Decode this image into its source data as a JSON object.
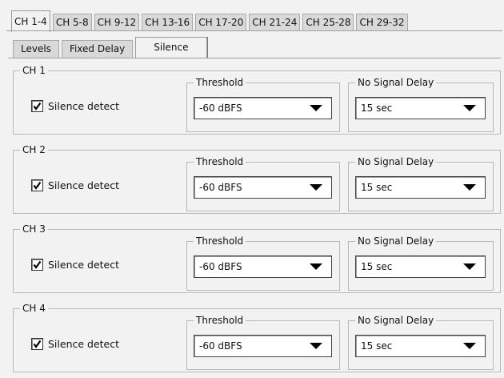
{
  "channel_tabs": [
    "CH 1-4",
    "CH 5-8",
    "CH 9-12",
    "CH 13-16",
    "CH 17-20",
    "CH 21-24",
    "CH 25-28",
    "CH 29-32"
  ],
  "sub_tabs": [
    "Levels",
    "Fixed Delay",
    "Silence"
  ],
  "channels": [
    {
      "title": "CH 1",
      "silence_label": "Silence detect",
      "checked": true,
      "threshold_label": "Threshold",
      "threshold_value": "-60 dBFS",
      "delay_label": "No Signal Delay",
      "delay_value": "15 sec"
    },
    {
      "title": "CH 2",
      "silence_label": "Silence detect",
      "checked": true,
      "threshold_label": "Threshold",
      "threshold_value": "-60 dBFS",
      "delay_label": "No Signal Delay",
      "delay_value": "15 sec"
    },
    {
      "title": "CH 3",
      "silence_label": "Silence detect",
      "checked": true,
      "threshold_label": "Threshold",
      "threshold_value": "-60 dBFS",
      "delay_label": "No Signal Delay",
      "delay_value": "15 sec"
    },
    {
      "title": "CH 4",
      "silence_label": "Silence detect",
      "checked": true,
      "threshold_label": "Threshold",
      "threshold_value": "-60 dBFS",
      "delay_label": "No Signal Delay",
      "delay_value": "15 sec"
    }
  ],
  "icons": {
    "checkbox": "checkmark-icon",
    "dropdown": "triangle-down-icon"
  }
}
